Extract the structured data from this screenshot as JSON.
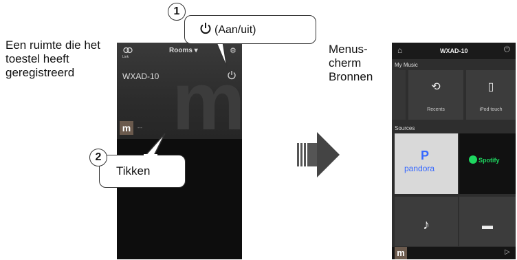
{
  "left_caption": "Een ruimte die het toestel heeft geregistreerd",
  "right_caption": "Menus-cherm Bronnen",
  "callout1": {
    "number": "1",
    "label": "(Aan/uit)"
  },
  "callout2": {
    "number": "2",
    "label": "Tikken"
  },
  "phone1": {
    "link_label": "Link",
    "rooms_label": "Rooms ▾",
    "device_name": "WXAD-10",
    "now_playing": "---",
    "thumb_letter": "m"
  },
  "phone2": {
    "title": "WXAD-10",
    "my_music_label": "My Music",
    "sources_label": "Sources",
    "tiles": [
      {
        "label": "Recents",
        "icon": "recents-icon"
      },
      {
        "label": "iPod touch",
        "icon": "ipod-icon"
      }
    ],
    "pandora_letter": "P",
    "pandora_label": "pandora",
    "spotify_label": "Spotify",
    "thumb_letter": "m"
  }
}
